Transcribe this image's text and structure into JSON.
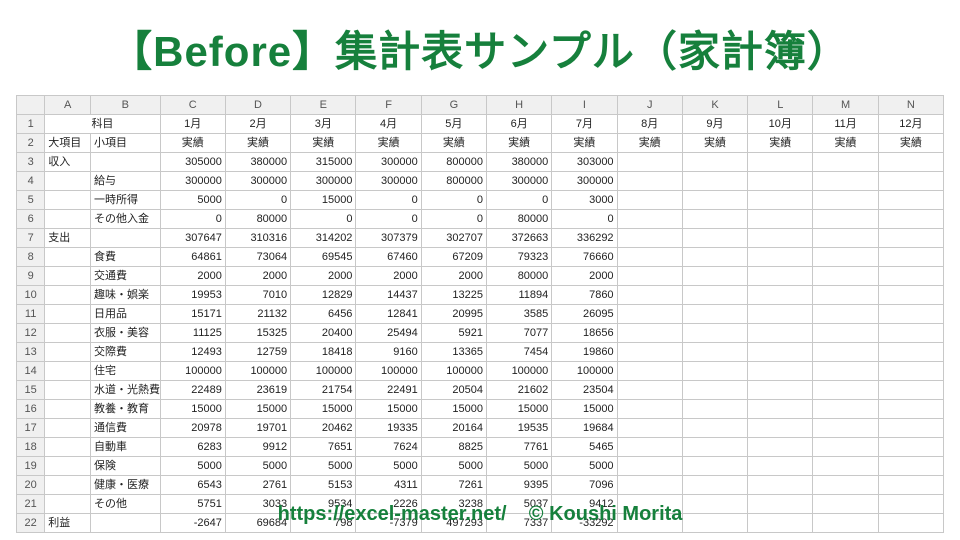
{
  "title": "【Before】集計表サンプル（家計簿）",
  "footer_url": "https://excel-master.net/",
  "footer_credit": "© Koushi Morita",
  "col_letters": [
    "A",
    "B",
    "C",
    "D",
    "E",
    "F",
    "G",
    "H",
    "I",
    "J",
    "K",
    "L",
    "M",
    "N"
  ],
  "header_row1": [
    "科目",
    "",
    "1月",
    "2月",
    "3月",
    "4月",
    "5月",
    "6月",
    "7月",
    "8月",
    "9月",
    "10月",
    "11月",
    "12月"
  ],
  "header_row2": [
    "大項目",
    "小項目",
    "実績",
    "実績",
    "実績",
    "実績",
    "実績",
    "実績",
    "実績",
    "実績",
    "実績",
    "実績",
    "実績",
    "実績"
  ],
  "data_rows": [
    {
      "rownum": "3",
      "A": "収入",
      "B": "",
      "vals": [
        "305000",
        "380000",
        "315000",
        "300000",
        "800000",
        "380000",
        "303000",
        "",
        "",
        "",
        "",
        ""
      ]
    },
    {
      "rownum": "4",
      "A": "",
      "B": "給与",
      "vals": [
        "300000",
        "300000",
        "300000",
        "300000",
        "800000",
        "300000",
        "300000",
        "",
        "",
        "",
        "",
        ""
      ]
    },
    {
      "rownum": "5",
      "A": "",
      "B": "一時所得",
      "vals": [
        "5000",
        "0",
        "15000",
        "0",
        "0",
        "0",
        "3000",
        "",
        "",
        "",
        "",
        ""
      ]
    },
    {
      "rownum": "6",
      "A": "",
      "B": "その他入金",
      "vals": [
        "0",
        "80000",
        "0",
        "0",
        "0",
        "80000",
        "0",
        "",
        "",
        "",
        "",
        ""
      ]
    },
    {
      "rownum": "7",
      "A": "支出",
      "B": "",
      "vals": [
        "307647",
        "310316",
        "314202",
        "307379",
        "302707",
        "372663",
        "336292",
        "",
        "",
        "",
        "",
        ""
      ]
    },
    {
      "rownum": "8",
      "A": "",
      "B": "食費",
      "vals": [
        "64861",
        "73064",
        "69545",
        "67460",
        "67209",
        "79323",
        "76660",
        "",
        "",
        "",
        "",
        ""
      ]
    },
    {
      "rownum": "9",
      "A": "",
      "B": "交通費",
      "vals": [
        "2000",
        "2000",
        "2000",
        "2000",
        "2000",
        "80000",
        "2000",
        "",
        "",
        "",
        "",
        ""
      ]
    },
    {
      "rownum": "10",
      "A": "",
      "B": "趣味・娯楽",
      "vals": [
        "19953",
        "7010",
        "12829",
        "14437",
        "13225",
        "11894",
        "7860",
        "",
        "",
        "",
        "",
        ""
      ]
    },
    {
      "rownum": "11",
      "A": "",
      "B": "日用品",
      "vals": [
        "15171",
        "21132",
        "6456",
        "12841",
        "20995",
        "3585",
        "26095",
        "",
        "",
        "",
        "",
        ""
      ]
    },
    {
      "rownum": "12",
      "A": "",
      "B": "衣服・美容",
      "vals": [
        "11125",
        "15325",
        "20400",
        "25494",
        "5921",
        "7077",
        "18656",
        "",
        "",
        "",
        "",
        ""
      ]
    },
    {
      "rownum": "13",
      "A": "",
      "B": "交際費",
      "vals": [
        "12493",
        "12759",
        "18418",
        "9160",
        "13365",
        "7454",
        "19860",
        "",
        "",
        "",
        "",
        ""
      ]
    },
    {
      "rownum": "14",
      "A": "",
      "B": "住宅",
      "vals": [
        "100000",
        "100000",
        "100000",
        "100000",
        "100000",
        "100000",
        "100000",
        "",
        "",
        "",
        "",
        ""
      ]
    },
    {
      "rownum": "15",
      "A": "",
      "B": "水道・光熱費",
      "vals": [
        "22489",
        "23619",
        "21754",
        "22491",
        "20504",
        "21602",
        "23504",
        "",
        "",
        "",
        "",
        ""
      ]
    },
    {
      "rownum": "16",
      "A": "",
      "B": "教養・教育",
      "vals": [
        "15000",
        "15000",
        "15000",
        "15000",
        "15000",
        "15000",
        "15000",
        "",
        "",
        "",
        "",
        ""
      ]
    },
    {
      "rownum": "17",
      "A": "",
      "B": "通信費",
      "vals": [
        "20978",
        "19701",
        "20462",
        "19335",
        "20164",
        "19535",
        "19684",
        "",
        "",
        "",
        "",
        ""
      ]
    },
    {
      "rownum": "18",
      "A": "",
      "B": "自動車",
      "vals": [
        "6283",
        "9912",
        "7651",
        "7624",
        "8825",
        "7761",
        "5465",
        "",
        "",
        "",
        "",
        ""
      ]
    },
    {
      "rownum": "19",
      "A": "",
      "B": "保険",
      "vals": [
        "5000",
        "5000",
        "5000",
        "5000",
        "5000",
        "5000",
        "5000",
        "",
        "",
        "",
        "",
        ""
      ]
    },
    {
      "rownum": "20",
      "A": "",
      "B": "健康・医療",
      "vals": [
        "6543",
        "2761",
        "5153",
        "4311",
        "7261",
        "9395",
        "7096",
        "",
        "",
        "",
        "",
        ""
      ]
    },
    {
      "rownum": "21",
      "A": "",
      "B": "その他",
      "vals": [
        "5751",
        "3033",
        "9534",
        "2226",
        "3238",
        "5037",
        "9412",
        "",
        "",
        "",
        "",
        ""
      ]
    },
    {
      "rownum": "22",
      "A": "利益",
      "B": "",
      "vals": [
        "-2647",
        "69684",
        "798",
        "-7379",
        "497293",
        "7337",
        "-33292",
        "",
        "",
        "",
        "",
        ""
      ]
    }
  ],
  "chart_data": {
    "type": "table",
    "title": "集計表サンプル（家計簿）",
    "columns": [
      "大項目",
      "小項目",
      "1月 実績",
      "2月 実績",
      "3月 実績",
      "4月 実績",
      "5月 実績",
      "6月 実績",
      "7月 実績",
      "8月 実績",
      "9月 実績",
      "10月 実績",
      "11月 実績",
      "12月 実績"
    ],
    "rows": [
      [
        "収入",
        "",
        305000,
        380000,
        315000,
        300000,
        800000,
        380000,
        303000,
        null,
        null,
        null,
        null,
        null
      ],
      [
        "収入",
        "給与",
        300000,
        300000,
        300000,
        300000,
        800000,
        300000,
        300000,
        null,
        null,
        null,
        null,
        null
      ],
      [
        "収入",
        "一時所得",
        5000,
        0,
        15000,
        0,
        0,
        0,
        3000,
        null,
        null,
        null,
        null,
        null
      ],
      [
        "収入",
        "その他入金",
        0,
        80000,
        0,
        0,
        0,
        80000,
        0,
        null,
        null,
        null,
        null,
        null
      ],
      [
        "支出",
        "",
        307647,
        310316,
        314202,
        307379,
        302707,
        372663,
        336292,
        null,
        null,
        null,
        null,
        null
      ],
      [
        "支出",
        "食費",
        64861,
        73064,
        69545,
        67460,
        67209,
        79323,
        76660,
        null,
        null,
        null,
        null,
        null
      ],
      [
        "支出",
        "交通費",
        2000,
        2000,
        2000,
        2000,
        2000,
        80000,
        2000,
        null,
        null,
        null,
        null,
        null
      ],
      [
        "支出",
        "趣味・娯楽",
        19953,
        7010,
        12829,
        14437,
        13225,
        11894,
        7860,
        null,
        null,
        null,
        null,
        null
      ],
      [
        "支出",
        "日用品",
        15171,
        21132,
        6456,
        12841,
        20995,
        3585,
        26095,
        null,
        null,
        null,
        null,
        null
      ],
      [
        "支出",
        "衣服・美容",
        11125,
        15325,
        20400,
        25494,
        5921,
        7077,
        18656,
        null,
        null,
        null,
        null,
        null
      ],
      [
        "支出",
        "交際費",
        12493,
        12759,
        18418,
        9160,
        13365,
        7454,
        19860,
        null,
        null,
        null,
        null,
        null
      ],
      [
        "支出",
        "住宅",
        100000,
        100000,
        100000,
        100000,
        100000,
        100000,
        100000,
        null,
        null,
        null,
        null,
        null
      ],
      [
        "支出",
        "水道・光熱費",
        22489,
        23619,
        21754,
        22491,
        20504,
        21602,
        23504,
        null,
        null,
        null,
        null,
        null
      ],
      [
        "支出",
        "教養・教育",
        15000,
        15000,
        15000,
        15000,
        15000,
        15000,
        15000,
        null,
        null,
        null,
        null,
        null
      ],
      [
        "支出",
        "通信費",
        20978,
        19701,
        20462,
        19335,
        20164,
        19535,
        19684,
        null,
        null,
        null,
        null,
        null
      ],
      [
        "支出",
        "自動車",
        6283,
        9912,
        7651,
        7624,
        8825,
        7761,
        5465,
        null,
        null,
        null,
        null,
        null
      ],
      [
        "支出",
        "保険",
        5000,
        5000,
        5000,
        5000,
        5000,
        5000,
        5000,
        null,
        null,
        null,
        null,
        null
      ],
      [
        "支出",
        "健康・医療",
        6543,
        2761,
        5153,
        4311,
        7261,
        9395,
        7096,
        null,
        null,
        null,
        null,
        null
      ],
      [
        "支出",
        "その他",
        5751,
        3033,
        9534,
        2226,
        3238,
        5037,
        9412,
        null,
        null,
        null,
        null,
        null
      ],
      [
        "利益",
        "",
        -2647,
        69684,
        798,
        -7379,
        497293,
        7337,
        -33292,
        null,
        null,
        null,
        null,
        null
      ]
    ]
  }
}
